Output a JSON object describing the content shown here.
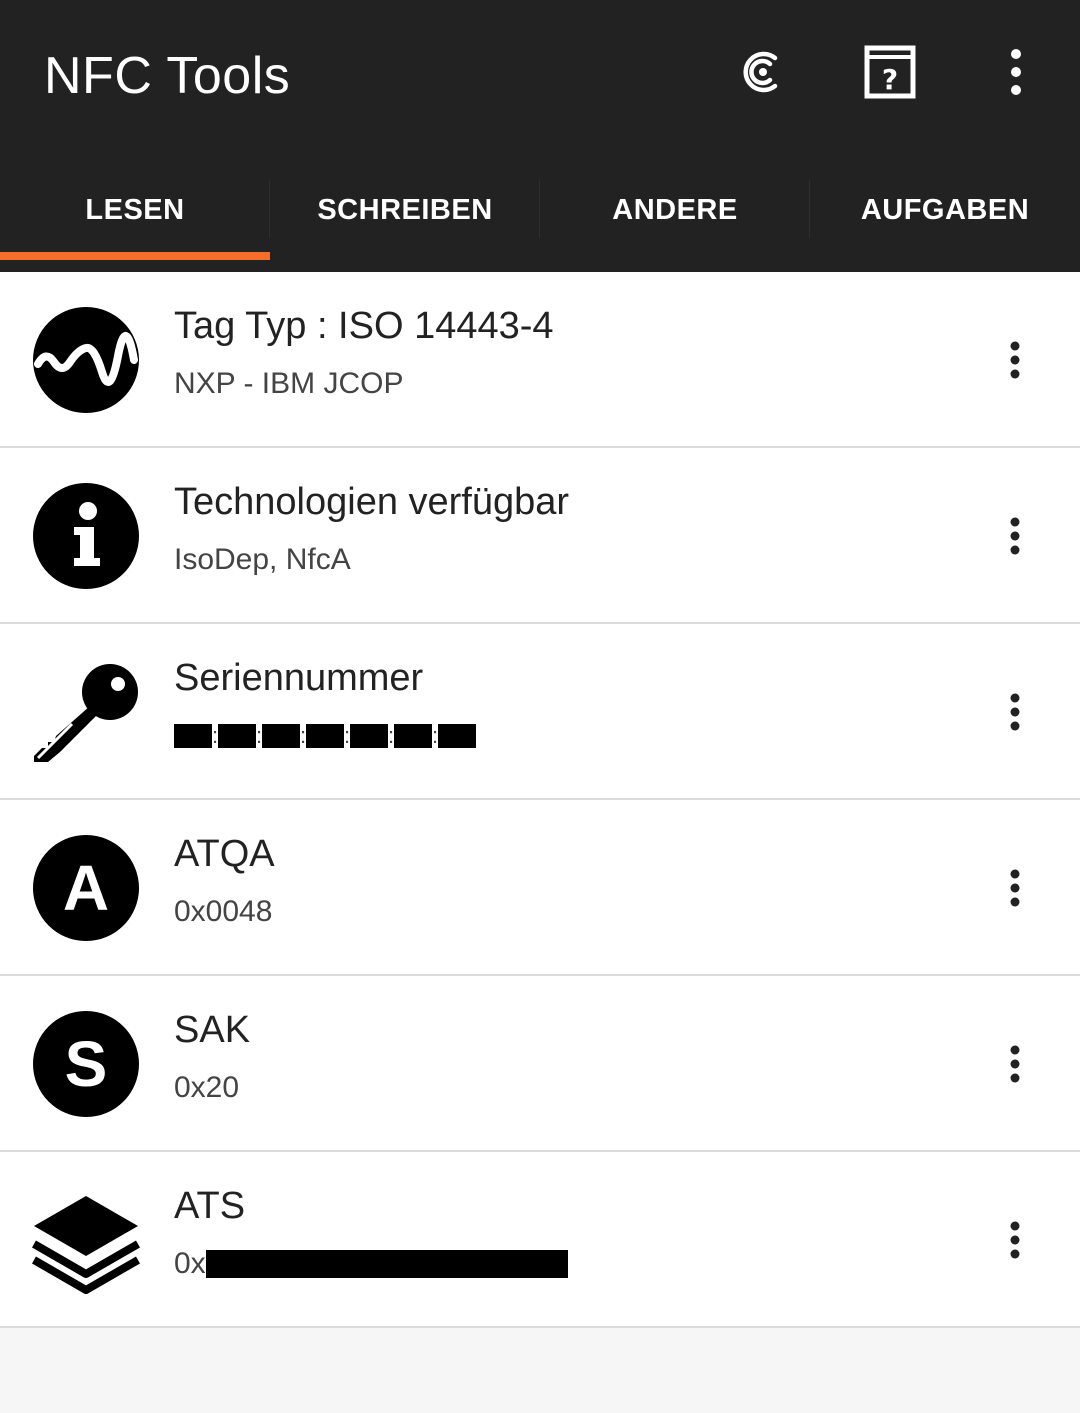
{
  "app": {
    "title": "NFC Tools"
  },
  "toolbar": {
    "actions": [
      {
        "icon": "pro-c-icon"
      },
      {
        "icon": "help-book-icon"
      },
      {
        "icon": "more-vert-icon"
      }
    ]
  },
  "tabs": [
    {
      "label": "LESEN",
      "selected": true
    },
    {
      "label": "SCHREIBEN",
      "selected": false
    },
    {
      "label": "ANDERE",
      "selected": false
    },
    {
      "label": "AUFGABEN",
      "selected": false
    }
  ],
  "accent_color": "#f36e2b",
  "items": [
    {
      "title": "Tag Typ : ISO 14443-4",
      "subtitle": "NXP - IBM JCOP",
      "icon": "wave-icon"
    },
    {
      "title": "Technologien verfügbar",
      "subtitle": "IsoDep, NfcA",
      "icon": "info-icon"
    },
    {
      "title": "Seriennummer",
      "subtitle": "",
      "subtitle_redacted": true,
      "icon": "key-icon"
    },
    {
      "title": "ATQA",
      "subtitle": "0x0048",
      "icon": "letter-a-icon"
    },
    {
      "title": "SAK",
      "subtitle": "0x20",
      "icon": "letter-s-icon"
    },
    {
      "title": "ATS",
      "subtitle": "0x",
      "subtitle_redacted": true,
      "icon": "layers-icon"
    }
  ]
}
